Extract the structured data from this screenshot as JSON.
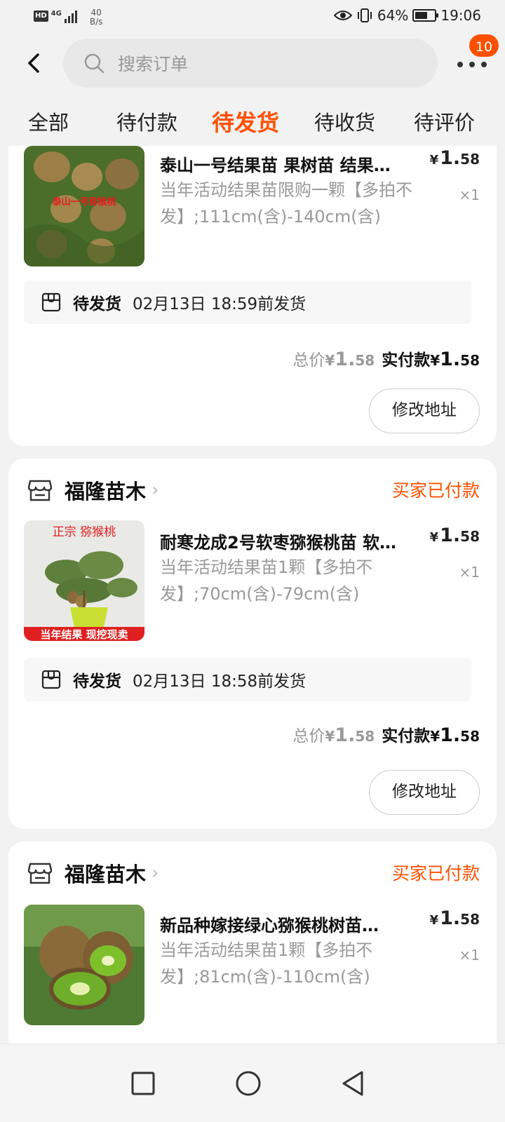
{
  "status_bar": {
    "hd": "HD",
    "network": "4G",
    "net_speed_value": "40",
    "net_speed_unit": "B/s",
    "battery": "64%",
    "battery_level": 0.64,
    "time": "19:06"
  },
  "header": {
    "search_placeholder": "搜索订单",
    "badge_count": "10"
  },
  "tabs": [
    {
      "label": "全部",
      "active": false
    },
    {
      "label": "待付款",
      "active": false
    },
    {
      "label": "待发货",
      "active": true
    },
    {
      "label": "待收货",
      "active": false
    },
    {
      "label": "待评价",
      "active": false
    }
  ],
  "orders": [
    {
      "title": "泰山一号结果苗 果树苗 结果…",
      "sku": "当年活动结果苗限购一颗【多拍不发】;111cm(含)-140cm(含)",
      "price_currency": "¥",
      "price_int": "1.",
      "price_dec": "58",
      "qty": "×1",
      "ship_status": "待发货",
      "ship_deadline": "02月13日 18:59前发货",
      "total_label": "总价",
      "total_currency": "¥",
      "total_int": "1.",
      "total_dec": "58",
      "paid_label": "实付款",
      "paid_currency": "¥",
      "paid_int": "1.",
      "paid_dec": "58",
      "button": "修改地址",
      "thumb_text": "泰山一号猕猴桃"
    },
    {
      "shop": "福隆苗木",
      "status": "买家已付款",
      "title": "耐寒龙成2号软枣猕猴桃苗 软…",
      "sku": "当年活动结果苗1颗【多拍不发】;70cm(含)-79cm(含)",
      "price_currency": "¥",
      "price_int": "1.",
      "price_dec": "58",
      "qty": "×1",
      "ship_status": "待发货",
      "ship_deadline": "02月13日 18:58前发货",
      "total_label": "总价",
      "total_currency": "¥",
      "total_int": "1.",
      "total_dec": "58",
      "paid_label": "实付款",
      "paid_currency": "¥",
      "paid_int": "1.",
      "paid_dec": "58",
      "button": "修改地址",
      "thumb_top": "正宗  猕猴桃",
      "thumb_bottom": "当年结果  现挖现卖"
    },
    {
      "shop": "福隆苗木",
      "status": "买家已付款",
      "title": "新品种嫁接绿心猕猴桃树苗…",
      "sku": "当年活动结果苗1颗【多拍不发】;81cm(含)-110cm(含)",
      "price_currency": "¥",
      "price_int": "1.",
      "price_dec": "58",
      "qty": "×1"
    }
  ],
  "colors": {
    "accent": "#ff5000",
    "background": "#f2f2f2",
    "muted_text": "#999999"
  },
  "icons": {
    "back": "chevron-left-icon",
    "search": "search-icon",
    "more": "more-dots-icon",
    "shop": "store-icon",
    "shipping": "package-icon",
    "nav": [
      "square-recents-icon",
      "circle-home-icon",
      "triangle-back-icon"
    ]
  }
}
